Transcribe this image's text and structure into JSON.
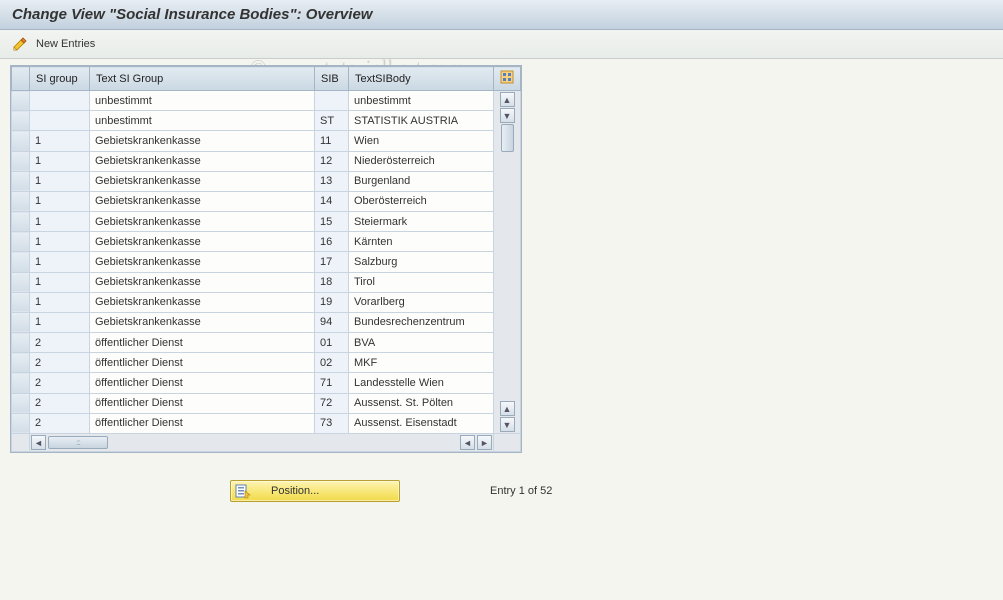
{
  "header": {
    "title": "Change View \"Social Insurance Bodies\": Overview"
  },
  "toolbar": {
    "new_entries": "New Entries"
  },
  "watermark": "© www.tutorialkart.com",
  "table": {
    "columns": {
      "si_group": "SI group",
      "text_si_group": "Text SI Group",
      "sib": "SIB",
      "text_si_body": "TextSIBody"
    },
    "rows": [
      {
        "si_group": "",
        "text_si_group": "unbestimmt",
        "sib": "",
        "text_si_body": "unbestimmt"
      },
      {
        "si_group": "",
        "text_si_group": "unbestimmt",
        "sib": "ST",
        "text_si_body": "STATISTIK AUSTRIA"
      },
      {
        "si_group": "1",
        "text_si_group": "Gebietskrankenkasse",
        "sib": "11",
        "text_si_body": "Wien"
      },
      {
        "si_group": "1",
        "text_si_group": "Gebietskrankenkasse",
        "sib": "12",
        "text_si_body": "Niederösterreich"
      },
      {
        "si_group": "1",
        "text_si_group": "Gebietskrankenkasse",
        "sib": "13",
        "text_si_body": "Burgenland"
      },
      {
        "si_group": "1",
        "text_si_group": "Gebietskrankenkasse",
        "sib": "14",
        "text_si_body": "Oberösterreich"
      },
      {
        "si_group": "1",
        "text_si_group": "Gebietskrankenkasse",
        "sib": "15",
        "text_si_body": "Steiermark"
      },
      {
        "si_group": "1",
        "text_si_group": "Gebietskrankenkasse",
        "sib": "16",
        "text_si_body": "Kärnten"
      },
      {
        "si_group": "1",
        "text_si_group": "Gebietskrankenkasse",
        "sib": "17",
        "text_si_body": "Salzburg"
      },
      {
        "si_group": "1",
        "text_si_group": "Gebietskrankenkasse",
        "sib": "18",
        "text_si_body": "Tirol"
      },
      {
        "si_group": "1",
        "text_si_group": "Gebietskrankenkasse",
        "sib": "19",
        "text_si_body": "Vorarlberg"
      },
      {
        "si_group": "1",
        "text_si_group": "Gebietskrankenkasse",
        "sib": "94",
        "text_si_body": "Bundesrechenzentrum"
      },
      {
        "si_group": "2",
        "text_si_group": "öffentlicher Dienst",
        "sib": "01",
        "text_si_body": "BVA"
      },
      {
        "si_group": "2",
        "text_si_group": "öffentlicher Dienst",
        "sib": "02",
        "text_si_body": "MKF"
      },
      {
        "si_group": "2",
        "text_si_group": "öffentlicher Dienst",
        "sib": "71",
        "text_si_body": "Landesstelle Wien"
      },
      {
        "si_group": "2",
        "text_si_group": "öffentlicher Dienst",
        "sib": "72",
        "text_si_body": "Aussenst. St. Pölten"
      },
      {
        "si_group": "2",
        "text_si_group": "öffentlicher Dienst",
        "sib": "73",
        "text_si_body": "Aussenst. Eisenstadt"
      }
    ]
  },
  "footer": {
    "position_label": "Position...",
    "entry_text": "Entry 1 of 52"
  }
}
